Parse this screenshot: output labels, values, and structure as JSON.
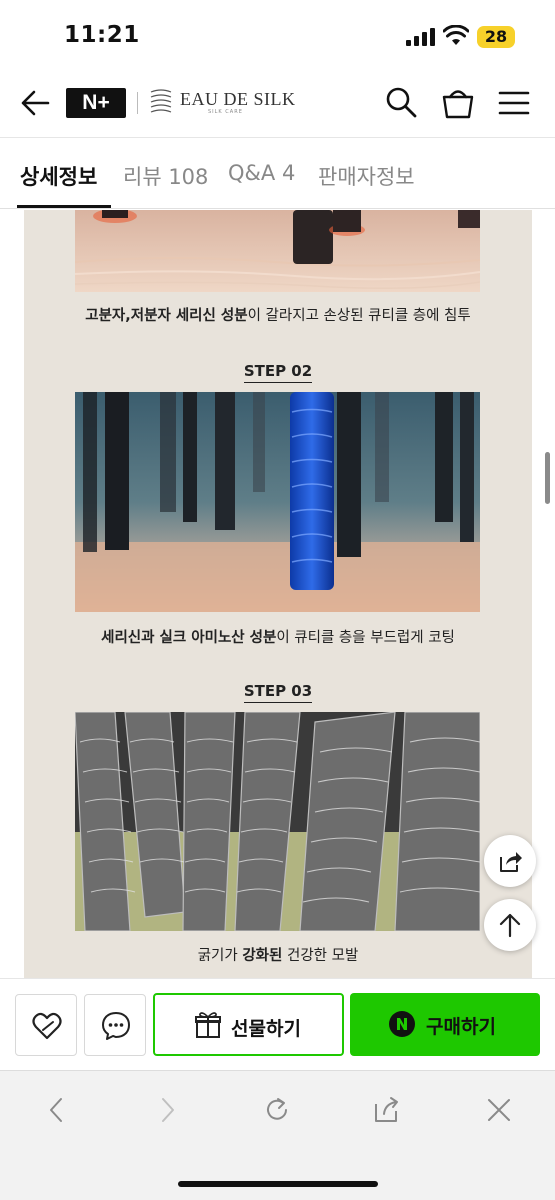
{
  "status_bar": {
    "time": "11:21",
    "battery": "28"
  },
  "header": {
    "naver_plus": "N+",
    "brand_name": "EAU DE SILK",
    "brand_sub": "SILK CARE"
  },
  "tabs": [
    {
      "label": "상세정보",
      "active": true
    },
    {
      "label": "리뷰 108",
      "active": false
    },
    {
      "label": "Q&A 4",
      "active": false
    },
    {
      "label": "판매자정보",
      "active": false
    }
  ],
  "content": {
    "caption1": {
      "bold": "고분자,저분자 세리신 성분",
      "rest": "이 갈라지고 손상된 큐티클 층에 침투"
    },
    "step2": "STEP 02",
    "caption2": {
      "bold": "세리신과 실크 아미노산 성분",
      "rest": "이 큐티클 층을 부드럽게 코팅"
    },
    "step3": "STEP 03",
    "caption3": {
      "pre": "굵기가 ",
      "bold": "강화된",
      "rest": " 건강한 모발"
    }
  },
  "buy_bar": {
    "gift_label": "선물하기",
    "buy_label": "구매하기"
  },
  "colors": {
    "naver_green": "#1ec800",
    "panel_bg": "#e8e3db"
  },
  "icons": [
    "back-arrow-icon",
    "search-icon",
    "shopping-bag-icon",
    "hamburger-menu-icon",
    "share-icon",
    "scroll-top-icon",
    "heart-icon",
    "chat-icon",
    "gift-icon",
    "naver-n-icon"
  ]
}
